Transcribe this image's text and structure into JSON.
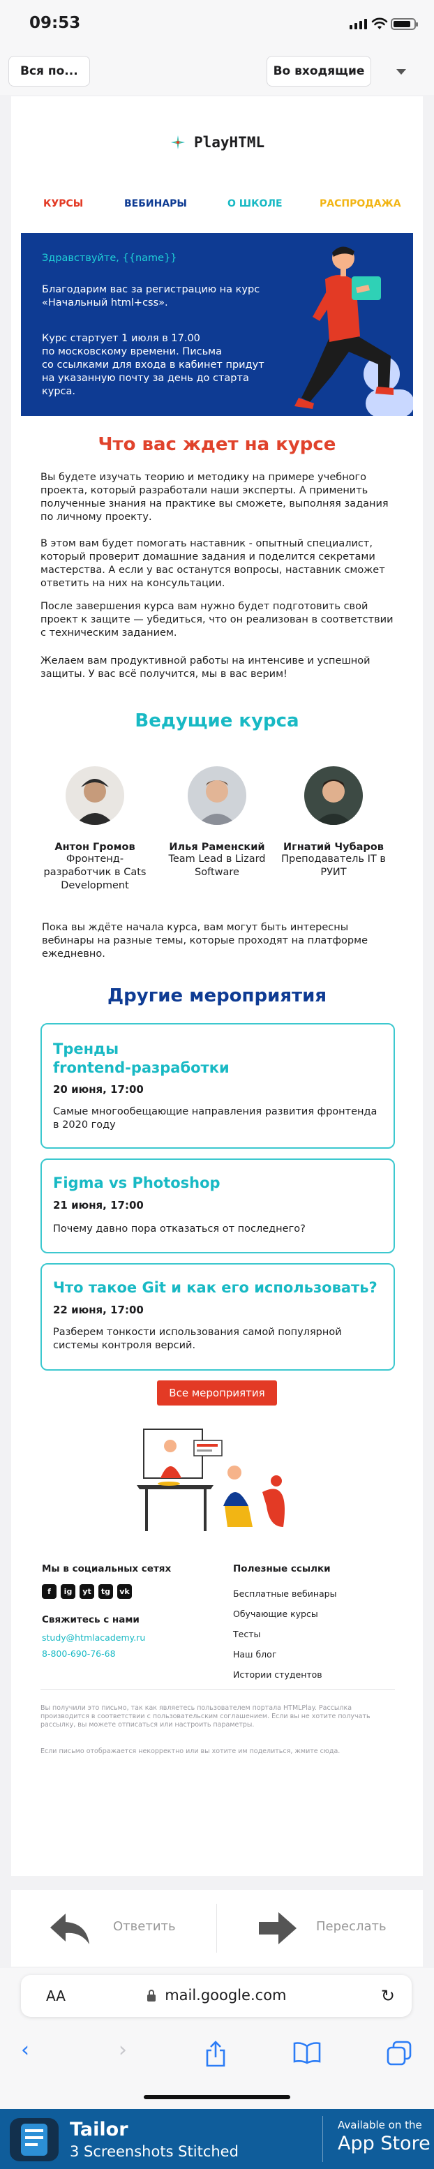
{
  "status_bar": {
    "time": "09:53"
  },
  "mail_toolbar": {
    "back_label": "Вся по...",
    "folder_label": "Во входящие"
  },
  "email": {
    "logo_text": "PlayHTML",
    "nav": [
      "КУРСЫ",
      "ВЕБИНАРЫ",
      "О ШКОЛЕ",
      "РАСПРОДАЖА"
    ],
    "nav_colors": [
      "#e33a25",
      "#0e3b93",
      "#18b9c4",
      "#f2b514"
    ],
    "hero": {
      "greeting": "Здравствуйте, {{name}}",
      "paragraph1": "Благодарим вас за регистрацию на курс\n«Начальный html+css».",
      "paragraph2": "Курс стартует 1 июля в 17.00\nпо московскому времени. Письма\nсо ссылками для входа в кабинет придут\nна указанную почту за день до старта курса."
    },
    "what_awaits": {
      "title": "Что вас ждет на курсе",
      "paragraphs": [
        "Вы будете изучать теорию и методику на примере учебного проекта, который разработали наши эксперты. А применить полученные знания на практике вы сможете, выполняя задания по личному проекту.",
        "В этом вам будет помогать наставник - опытный специалист, который проверит домашние задания и поделится секретами мастерства. А если у вас останутся вопросы, наставник сможет ответить на них на консультации.",
        "После завершения курса вам нужно будет подготовить свой проект к защите — убедиться, что он реализован в соответствии с техническим заданием.",
        "Желаем вам продуктивной работы на интенсиве и успешной защиты. У вас всё получится, мы в вас верим!"
      ]
    },
    "teachers": {
      "title": "Ведущие курса",
      "items": [
        {
          "name": "Антон Громов",
          "role": "Фронтенд-разработчик в Cats Development"
        },
        {
          "name": "Илья Раменский",
          "role": "Team Lead в Lizard Software"
        },
        {
          "name": "Игнатий Чубаров",
          "role": "Преподаватель IT в РУИТ"
        }
      ]
    },
    "intro_events": "Пока вы ждёте начала курса, вам могут быть интересны вебинары на разные темы, которые проходят на платформе ежедневно.",
    "events": {
      "title": "Другие мероприятия",
      "items": [
        {
          "title": "Тренды\nfrontend-разработки",
          "date": "20 июня, 17:00",
          "text": "Самые многообещающие направления развития фронтенда в 2020 году"
        },
        {
          "title": "Figma vs Photoshop",
          "date": "21 июня, 17:00",
          "text": "Почему давно пора отказаться от последнего?"
        },
        {
          "title": "Что такое Git и как его использовать?",
          "date": "22 июня, 17:00",
          "text": "Разберем тонкости использования самой популярной системы контроля версий."
        }
      ],
      "all_button": "Все мероприятия"
    },
    "footer": {
      "social_title": "Мы в социальных сетях",
      "social_icons": [
        "f",
        "ig",
        "yt",
        "tg",
        "vk"
      ],
      "contact_title": "Свяжитесь с нами",
      "email": "study@htmlacademy.ru",
      "phone": "8-800-690-76-68",
      "links_title": "Полезные ссылки",
      "links": [
        "Бесплатные вебинары",
        "Обучающие курсы",
        "Тесты",
        "Наш блог",
        "Истории студентов"
      ],
      "legal1": "Вы получили это письмо, так как являетесь пользователем портала HTMLPlay. Рассылка производится в соответствии с пользовательским соглашением. Если вы не хотите получать рассылку, вы можете отписаться или настроить параметры.",
      "legal2": "Если письмо отображается некорректно или вы хотите им поделиться, жмите сюда."
    }
  },
  "reply_bar": {
    "reply": "Ответить",
    "forward": "Переслать"
  },
  "safari": {
    "aa": "AA",
    "url": "mail.google.com"
  },
  "banner": {
    "app": "Tailor",
    "subtitle": "3 Screenshots Stitched",
    "store_line1": "Available on the",
    "store_line2": "App Store"
  }
}
